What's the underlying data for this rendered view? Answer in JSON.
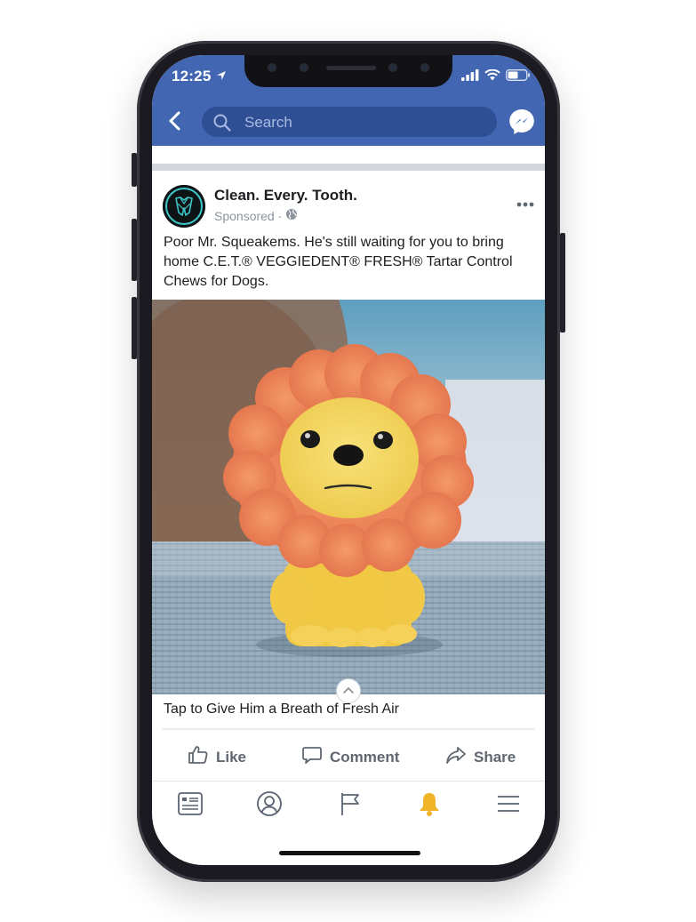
{
  "status_bar": {
    "time": "12:25",
    "icons": [
      "location-arrow-icon",
      "signal-bars-icon",
      "wifi-icon",
      "battery-icon"
    ]
  },
  "nav": {
    "search_placeholder": "Search",
    "icons": [
      "back-arrow-icon",
      "search-icon",
      "messenger-icon"
    ]
  },
  "post": {
    "page_name": "Clean. Every. Tooth.",
    "sponsored_label": "Sponsored ·",
    "body_text": "Poor Mr. Squeakems. He's still waiting for you to bring home C.E.T.® VEGGIEDENT® FRESH® Tartar Control Chews for Dogs.",
    "media_subject": "orange lion toy",
    "caption": "Tap to Give Him a Breath of Fresh Air"
  },
  "actions": {
    "like": "Like",
    "comment": "Comment",
    "share": "Share"
  },
  "tab_bar": {
    "tabs": [
      "news-feed-icon",
      "profile-icon",
      "pages-flag-icon",
      "notifications-bell-icon",
      "menu-icon"
    ],
    "active_tab": "notifications-bell-icon"
  },
  "colors": {
    "facebook_blue": "#4266b2",
    "search_field": "#2f4f95",
    "bell_active": "#f0b429",
    "text_primary": "#1c1e21",
    "text_secondary": "#606770"
  }
}
